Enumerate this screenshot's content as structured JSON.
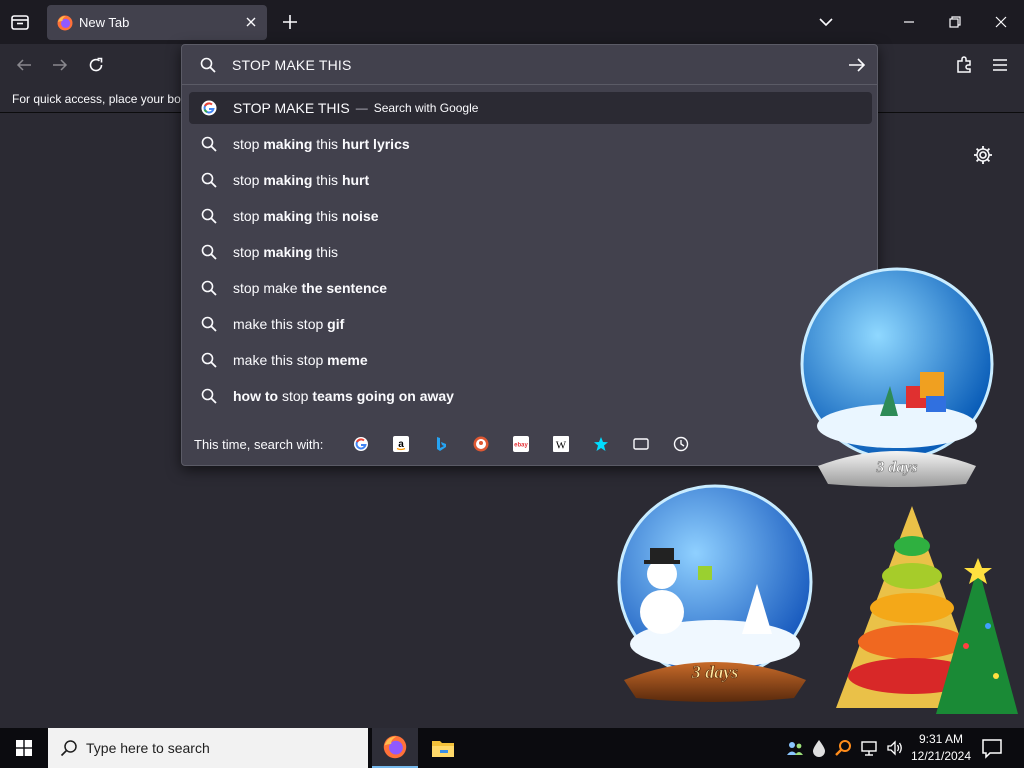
{
  "tab": {
    "title": "New Tab"
  },
  "bookmarks": {
    "hint": "For quick access, place your boo"
  },
  "urlbar": {
    "value": "STOP MAKE THIS"
  },
  "results": [
    {
      "pre": "STOP MAKE THIS",
      "bold": "",
      "post": "",
      "action": "Search with Google",
      "icon": "google-icon",
      "selected": true
    },
    {
      "pre": "stop ",
      "bold": "making",
      "post": " this ",
      "bold2": "hurt lyrics",
      "icon": "search-icon"
    },
    {
      "pre": "stop ",
      "bold": "making",
      "post": " this ",
      "bold2": "hurt",
      "icon": "search-icon"
    },
    {
      "pre": "stop ",
      "bold": "making",
      "post": " this ",
      "bold2": "noise",
      "icon": "search-icon"
    },
    {
      "pre": "stop ",
      "bold": "making",
      "post": " this",
      "bold2": "",
      "icon": "search-icon"
    },
    {
      "pre": "stop make ",
      "bold": "the sentence",
      "post": "",
      "bold2": "",
      "icon": "search-icon"
    },
    {
      "pre": "make this stop ",
      "bold": "gif",
      "post": "",
      "bold2": "",
      "icon": "search-icon"
    },
    {
      "pre": "make this stop ",
      "bold": "meme",
      "post": "",
      "bold2": "",
      "icon": "search-icon"
    },
    {
      "pre": "",
      "bold": "how to",
      "post": " stop ",
      "bold2": "teams going on away",
      "icon": "search-icon"
    }
  ],
  "one_offs": {
    "label": "This time, search with:",
    "engines": [
      "google-icon",
      "amazon-icon",
      "bing-icon",
      "duckduckgo-icon",
      "ebay-icon",
      "wikipedia-icon",
      "bookmarks-star-icon",
      "tabs-icon",
      "history-icon"
    ]
  },
  "snowglobes": {
    "label_top": "3 days",
    "label_bottom": "3 days"
  },
  "taskbar": {
    "search_placeholder": "Type here to search",
    "time": "9:31 AM",
    "date": "12/21/2024"
  },
  "colors": {
    "toolbar": "#2b2a33",
    "popup": "#42414d",
    "taskbar": "#0b0b0f",
    "accent": "#76b9ed"
  }
}
